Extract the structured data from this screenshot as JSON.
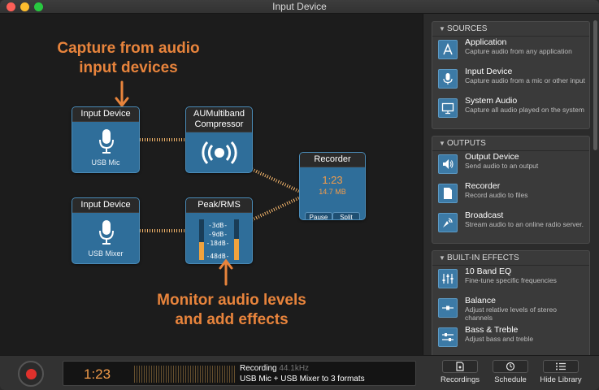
{
  "window": {
    "title": "Input Device"
  },
  "canvas": {
    "callout_top": [
      "Capture from audio",
      "input devices"
    ],
    "callout_bottom": [
      "Monitor audio levels",
      "and add effects"
    ],
    "nodes": {
      "input1": {
        "title": "Input Device",
        "label": "USB Mic"
      },
      "input2": {
        "title": "Input Device",
        "label": "USB Mixer"
      },
      "compressor": {
        "title_line1": "AUMultiband",
        "title_line2": "Compressor"
      },
      "peak": {
        "title": "Peak/RMS",
        "meter_labels": [
          "-3dB-",
          "-9dB-",
          "-18dB-",
          "-48dB-"
        ]
      },
      "recorder": {
        "title": "Recorder",
        "time": "1:23",
        "size": "14.7 MB",
        "pause_label": "Pause",
        "split_label": "Split"
      }
    }
  },
  "sidebar": {
    "sources": {
      "header": "SOURCES",
      "items": [
        {
          "title": "Application",
          "desc": "Capture audio from any application",
          "icon": "app-store-icon"
        },
        {
          "title": "Input Device",
          "desc": "Capture audio from a mic or other input",
          "icon": "microphone-icon"
        },
        {
          "title": "System Audio",
          "desc": "Capture all audio played on the system",
          "icon": "monitor-icon"
        }
      ]
    },
    "outputs": {
      "header": "OUTPUTS",
      "items": [
        {
          "title": "Output Device",
          "desc": "Send audio to an output",
          "icon": "speaker-icon"
        },
        {
          "title": "Recorder",
          "desc": "Record audio to files",
          "icon": "document-icon"
        },
        {
          "title": "Broadcast",
          "desc": "Stream audio to an online radio server.",
          "icon": "broadcast-icon"
        }
      ]
    },
    "effects": {
      "header": "BUILT-IN EFFECTS",
      "items": [
        {
          "title": "10 Band EQ",
          "desc": "Fine-tune specific frequencies",
          "icon": "eq-icon"
        },
        {
          "title": "Balance",
          "desc": "Adjust relative levels of stereo channels",
          "icon": "balance-icon"
        },
        {
          "title": "Bass & Treble",
          "desc": "Adjust bass and treble",
          "icon": "bass-treble-icon"
        }
      ]
    }
  },
  "bottombar": {
    "time": "1:23",
    "status": "Recording",
    "rate": "44.1kHz",
    "summary": "USB Mic + USB Mixer to 3 formats",
    "recordings_label": "Recordings",
    "schedule_label": "Schedule",
    "hide_library_label": "Hide Library"
  },
  "colors": {
    "accent": "#e8843c",
    "node_blue": "#2f6e9a",
    "record_red": "#e0312c"
  }
}
